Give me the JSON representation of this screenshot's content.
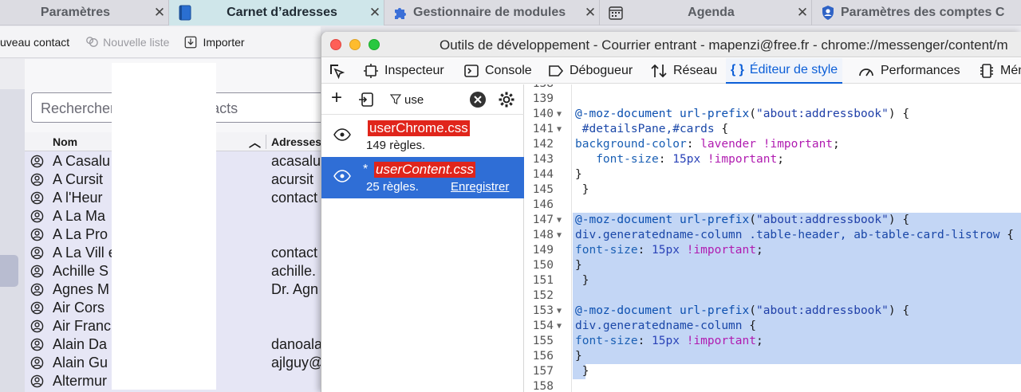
{
  "tabs": [
    {
      "label": "Paramètres",
      "close": "✕"
    },
    {
      "label": "Carnet d’adresses",
      "close": "✕"
    },
    {
      "label": "Gestionnaire de modules",
      "close": "✕"
    },
    {
      "label": "Agenda",
      "close": "✕"
    },
    {
      "label": "Paramètres des comptes C",
      "close": ""
    }
  ],
  "ab_toolbar": {
    "new_contact": "uveau contact",
    "new_list": "Nouvelle liste",
    "import": "Importer"
  },
  "ab_search": {
    "placeholder": "Rechercher dans MacContacts"
  },
  "list_header": {
    "name": "Nom",
    "email": "Adresses"
  },
  "contacts": [
    {
      "name": "A Casalu",
      "email": "acasalu"
    },
    {
      "name": "A Cursit",
      "email": "acursit"
    },
    {
      "name": "A l'Heur",
      "email": "contact"
    },
    {
      "name": "A La Ma",
      "email": ""
    },
    {
      "name": "A La Pro",
      "email": ""
    },
    {
      "name": "A La Vill                  e",
      "email": "contact"
    },
    {
      "name": "Achille S",
      "email": "achille."
    },
    {
      "name": "Agnes M",
      "email": "Dr. Agn"
    },
    {
      "name": "Air Cors",
      "email": ""
    },
    {
      "name": "Air Franc                  éser...",
      "email": ""
    },
    {
      "name": "Alain Da",
      "email": "danoala"
    },
    {
      "name": "Alain Gu",
      "email": "ajlguy@"
    },
    {
      "name": "Altermur",
      "email": ""
    }
  ],
  "devtools": {
    "title": "Outils de développement - Courrier entrant - mapenzi@free.fr - chrome://messenger/content/m",
    "tools": [
      {
        "label": "Inspecteur",
        "icon": "inspector-icon"
      },
      {
        "label": "Console",
        "icon": "console-icon"
      },
      {
        "label": "Débogueur",
        "icon": "debugger-icon"
      },
      {
        "label": "Réseau",
        "icon": "network-icon"
      },
      {
        "label": "Éditeur de style",
        "icon": "style-editor-icon"
      },
      {
        "label": "Performances",
        "icon": "performance-icon"
      },
      {
        "label": "Mén",
        "icon": "memory-icon"
      }
    ],
    "filter_text": "use",
    "sheets": [
      {
        "name": "userChrome.css",
        "rules": "149 règles.",
        "modified": ""
      },
      {
        "name": "userContent.css",
        "rules": "25 règles.",
        "modified": "*",
        "save": "Enregistrer"
      }
    ]
  },
  "code_lines": [
    {
      "n": "138",
      "t": ""
    },
    {
      "n": "139",
      "t": ""
    },
    {
      "n": "140",
      "t": "@-moz-document url-prefix(\"about:addressbook\") {"
    },
    {
      "n": "141",
      "t": " #detailsPane,#cards {"
    },
    {
      "n": "142",
      "t": "background-color: lavender !important;"
    },
    {
      "n": "143",
      "t": "   font-size: 15px !important;"
    },
    {
      "n": "144",
      "t": "}"
    },
    {
      "n": "145",
      "t": " }"
    },
    {
      "n": "146",
      "t": ""
    },
    {
      "n": "147",
      "t": "@-moz-document url-prefix(\"about:addressbook\") {"
    },
    {
      "n": "148",
      "t": "div.generatedname-column .table-header, ab-table-card-listrow {"
    },
    {
      "n": "149",
      "t": "font-size: 15px !important;"
    },
    {
      "n": "150",
      "t": "}"
    },
    {
      "n": "151",
      "t": " }"
    },
    {
      "n": "152",
      "t": ""
    },
    {
      "n": "153",
      "t": "@-moz-document url-prefix(\"about:addressbook\") {"
    },
    {
      "n": "154",
      "t": "div.generatedname-column {"
    },
    {
      "n": "155",
      "t": "font-size: 15px !important;"
    },
    {
      "n": "156",
      "t": "}"
    },
    {
      "n": "157",
      "t": " }"
    },
    {
      "n": "158",
      "t": ""
    }
  ],
  "colors": {
    "accent": "#2f6ed6",
    "sheet_badge": "#e0251b",
    "selection": "#c3d6f5",
    "lavender": "#e6e6f5"
  }
}
